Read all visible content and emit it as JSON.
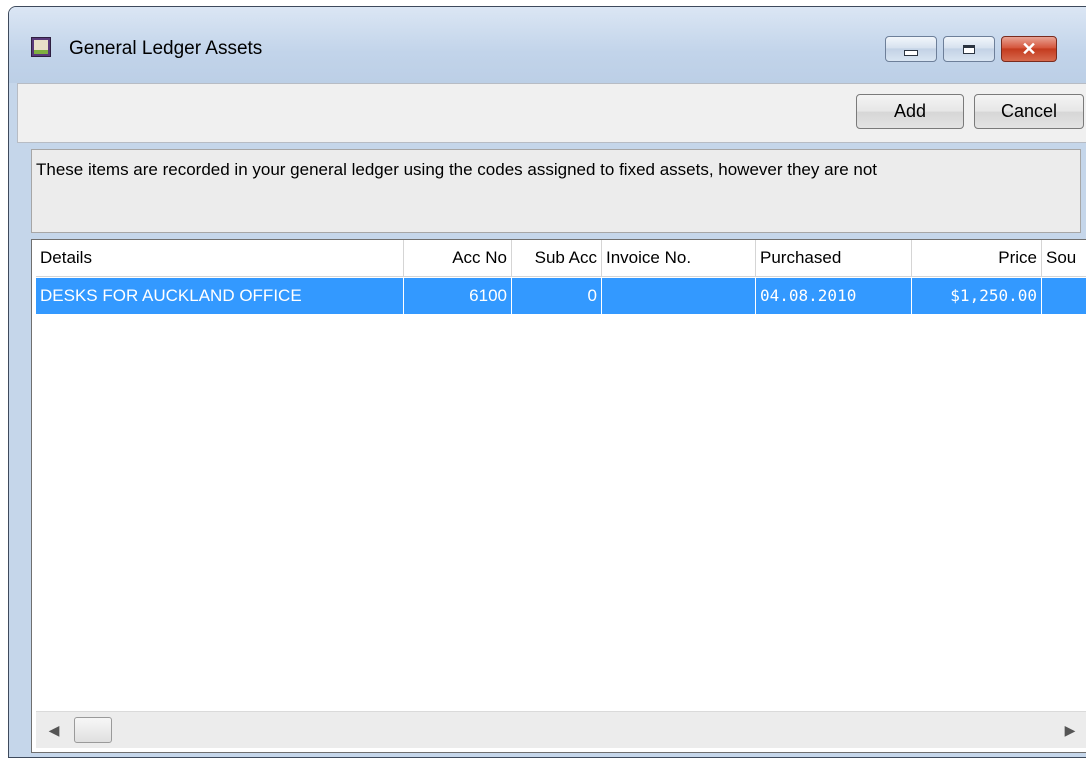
{
  "window": {
    "title": "General Ledger Assets",
    "icon": "ledger-app-icon"
  },
  "caption_buttons": {
    "minimize_icon": "minimize-icon",
    "maximize_icon": "maximize-icon",
    "close_label": "✕"
  },
  "toolbar": {
    "add_label": "Add",
    "cancel_label": "Cancel"
  },
  "info_text": "These items are recorded in your general ledger using the codes assigned to fixed assets, however they are not",
  "table": {
    "columns": [
      "Details",
      "Acc No",
      "Sub Acc",
      "Invoice No.",
      "Purchased",
      "Price",
      "Sou"
    ],
    "rows": [
      [
        "DESKS FOR AUCKLAND OFFICE",
        "6100",
        "0",
        "",
        "04.08.2010",
        "$1,250.00",
        ""
      ]
    ],
    "selected_row": 0
  },
  "scrollbar": {
    "left_arrow": "◀",
    "right_arrow": "▶"
  },
  "colors": {
    "selection": "#3399ff",
    "titlebar": "#c5d6ea",
    "close_button": "#c43b1f"
  }
}
